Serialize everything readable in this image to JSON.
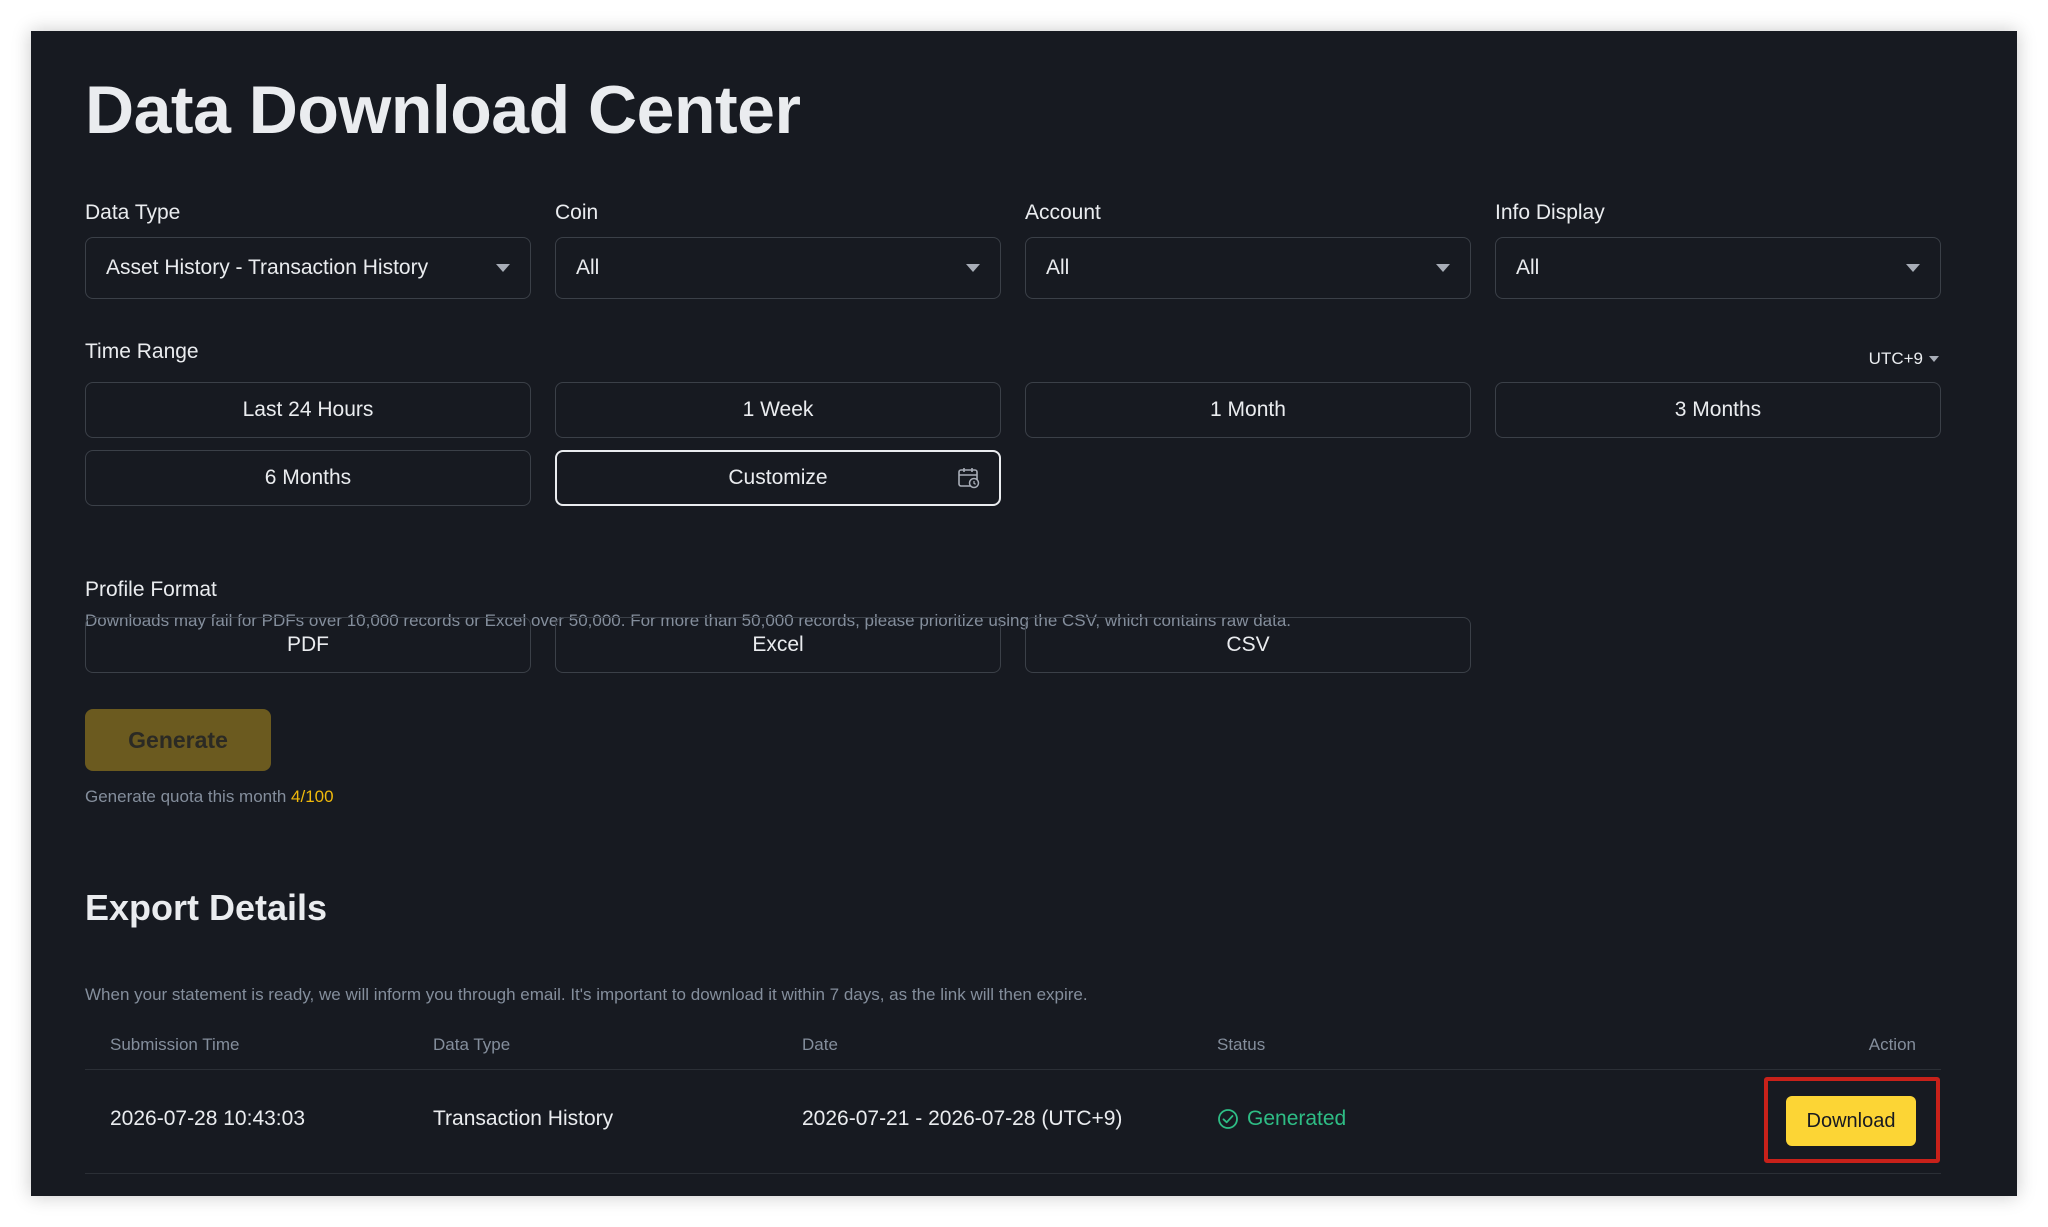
{
  "page": {
    "title": "Data Download Center"
  },
  "filters": {
    "data_type": {
      "label": "Data Type",
      "value": "Asset History - Transaction History"
    },
    "coin": {
      "label": "Coin",
      "value": "All"
    },
    "account": {
      "label": "Account",
      "value": "All"
    },
    "info_display": {
      "label": "Info Display",
      "value": "All"
    }
  },
  "time_range": {
    "label": "Time Range",
    "timezone": "UTC+9",
    "options": [
      "Last 24 Hours",
      "1 Week",
      "1 Month",
      "3 Months",
      "6 Months",
      "Customize"
    ],
    "selected": "Customize"
  },
  "profile_format": {
    "label": "Profile Format",
    "hint": "Downloads may fail for PDFs over 10,000 records or Excel over 50,000. For more than 50,000 records, please prioritize using the CSV, which contains raw data.",
    "options": [
      "PDF",
      "Excel",
      "CSV"
    ]
  },
  "generate": {
    "label": "Generate",
    "quota_label": "Generate quota this month",
    "quota_value": "4/100"
  },
  "export": {
    "title": "Export Details",
    "hint": "When your statement is ready, we will inform you through email. It's important to download it within 7 days, as the link will then expire.",
    "columns": [
      "Submission Time",
      "Data Type",
      "Date",
      "Status",
      "Action"
    ],
    "rows": [
      {
        "submission_time": "2026-07-28 10:43:03",
        "data_type": "Transaction History",
        "date": "2026-07-21 - 2026-07-28 (UTC+9)",
        "status": "Generated",
        "action": "Download"
      }
    ]
  },
  "colors": {
    "panel_bg": "#171a21",
    "accent": "#fcd535",
    "success": "#2ebd85",
    "highlight": "#c8211a"
  },
  "icons": [
    "chevron-down-icon",
    "calendar-icon",
    "check-circle-icon"
  ]
}
